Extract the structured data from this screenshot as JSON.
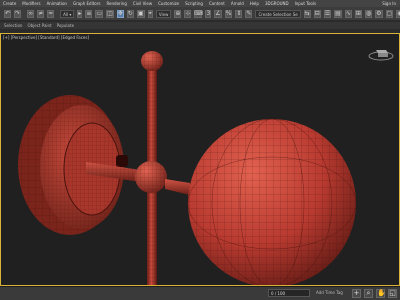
{
  "menu": {
    "items": [
      "Create",
      "Modifiers",
      "Animation",
      "Graph Editors",
      "Rendering",
      "Civil View",
      "Customize",
      "Scripting",
      "Content",
      "Arnold",
      "Help",
      "3DGROUND",
      "Input Tools"
    ],
    "sign_in": "Sign In"
  },
  "toolbar": {
    "view_dropdown": "View",
    "selection_set": "Create Selection Se"
  },
  "ribbon": {
    "tabs": [
      "Selection",
      "Object Paint",
      "Populate"
    ]
  },
  "viewport": {
    "label": "[+] [Perspective] [Standard] [Edged Faces]",
    "model_color": "#b83a30"
  },
  "status": {
    "frame_readout": "0 / 100",
    "time_tag": "Add Time Tag"
  },
  "colors": {
    "selection_frame": "#d9b23a",
    "viewport_bg": "#202020"
  }
}
